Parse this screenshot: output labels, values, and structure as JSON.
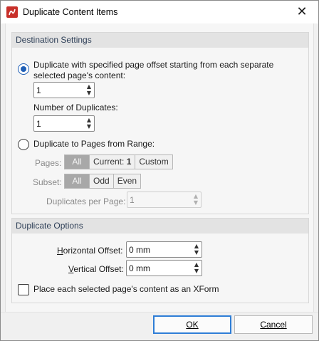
{
  "window": {
    "title": "Duplicate Content Items"
  },
  "destination": {
    "header": "Destination Settings",
    "option1_line1": "Duplicate with specified page offset starting from each separate",
    "option1_line2": "selected page's content:",
    "offset_value": "1",
    "num_duplicates_label": "Number of Duplicates:",
    "num_duplicates_value": "1",
    "option2_label": "Duplicate to Pages from Range:",
    "pages_label": "Pages:",
    "pages_segments": [
      "All",
      "Current: ",
      "Custom"
    ],
    "pages_current_num": "1",
    "subset_label": "Subset:",
    "subset_segments": [
      "All",
      "Odd",
      "Even"
    ],
    "dup_per_page_label": "Duplicates per Page:",
    "dup_per_page_value": "1"
  },
  "options": {
    "header": "Duplicate Options",
    "h_offset_label": "Horizontal Offset:",
    "h_offset_value": "0 mm",
    "v_offset_label": "Vertical Offset:",
    "v_offset_value": "0 mm",
    "xform_label": "Place each selected page's content as an XForm"
  },
  "buttons": {
    "ok": "OK",
    "cancel": "Cancel"
  },
  "colors": {
    "accent": "#1f5fb6",
    "brand": "#c8302a",
    "header_text": "#2e3f57"
  }
}
